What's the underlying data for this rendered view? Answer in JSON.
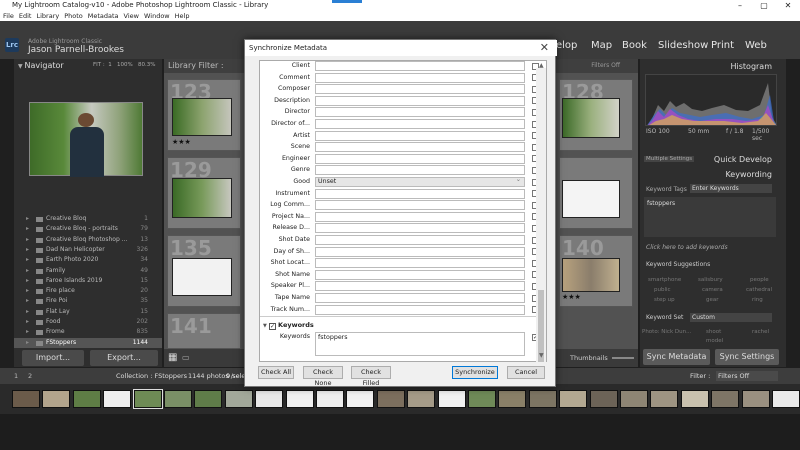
{
  "window": {
    "title": "My Lightroom Catalog-v10 - Adobe Photoshop Lightroom Classic - Library",
    "menu": [
      "File",
      "Edit",
      "Library",
      "Photo",
      "Metadata",
      "View",
      "Window",
      "Help"
    ],
    "controls": {
      "minimize": "–",
      "maximize": "▢",
      "close": "✕"
    }
  },
  "header": {
    "logo": "Lrc",
    "app_name": "Adobe Lightroom Classic",
    "user_name": "Jason Parnell-Brookes",
    "modules": [
      "elop",
      "Map",
      "Book",
      "Slideshow",
      "Print",
      "Web"
    ]
  },
  "navigator": {
    "title": "Navigator",
    "zoom_options": [
      "FIT",
      "1",
      "100%",
      "80.3%"
    ]
  },
  "collections": [
    {
      "name": "Creative Bloq",
      "count": "1"
    },
    {
      "name": "Creative Bloq - portraits",
      "count": "79"
    },
    {
      "name": "Creative Bloq Photoshop ...",
      "count": "13"
    },
    {
      "name": "Dad Nan Helicopter",
      "count": "326"
    },
    {
      "name": "Earth Photo 2020",
      "count": "34"
    },
    {
      "name": "Family",
      "count": "49"
    },
    {
      "name": "Faroe Islands 2019",
      "count": "15"
    },
    {
      "name": "Fire place",
      "count": "20"
    },
    {
      "name": "Fire Poi",
      "count": "35"
    },
    {
      "name": "Flat Lay",
      "count": "15"
    },
    {
      "name": "Food",
      "count": "202"
    },
    {
      "name": "Frome",
      "count": "835"
    },
    {
      "name": "FStoppers",
      "count": "1144",
      "selected": true
    }
  ],
  "left_buttons": {
    "import": "Import...",
    "export": "Export..."
  },
  "library_filter": {
    "label": "Library Filter :",
    "filters_off": "Filters Off"
  },
  "grid": {
    "cell_numbers": [
      "123",
      "128",
      "129",
      "135",
      "140",
      "141"
    ],
    "stars": "★★★",
    "thumbnails_label": "Thumbnails"
  },
  "right_panel": {
    "histogram": "Histogram",
    "exif": {
      "iso": "ISO 100",
      "focal": "50 mm",
      "aperture": "f / 1.8",
      "shutter": "1/500 sec"
    },
    "quick_develop": "Quick Develop",
    "multiple_settings": "Multiple Settings",
    "keywording": "Keywording",
    "keyword_tags_label": "Keyword Tags",
    "keyword_tags_value": "Enter Keywords",
    "keywords_value": "fstoppers",
    "click_to_add": "Click here to add keywords",
    "keyword_suggestions": "Keyword Suggestions",
    "suggestions": [
      "smartphone",
      "salisbury",
      "people",
      "public",
      "camera",
      "cathedral",
      "step up",
      "gear",
      "ring"
    ],
    "keyword_set_label": "Keyword Set",
    "keyword_set_value": "Custom",
    "keyword_set_items": [
      "Photo: Nick Dun...",
      "shoot",
      "rachel",
      "",
      "model",
      ""
    ],
    "sync_metadata": "Sync Metadata",
    "sync_settings": "Sync Settings"
  },
  "filmstrip_bar": {
    "collection": "Collection : FStoppers",
    "count": "1144 photos /",
    "selected": "9 selec",
    "filter_label": "Filter :",
    "filter_value": "Filters Off",
    "pages": [
      "1",
      "2"
    ]
  },
  "dialog": {
    "title": "Synchronize Metadata",
    "close": "✕",
    "fields": [
      {
        "label": "Client",
        "value": ""
      },
      {
        "label": "Comment",
        "value": ""
      },
      {
        "label": "Composer",
        "value": ""
      },
      {
        "label": "Description",
        "value": ""
      },
      {
        "label": "Director",
        "value": ""
      },
      {
        "label": "Director of...",
        "value": ""
      },
      {
        "label": "Artist",
        "value": ""
      },
      {
        "label": "Scene",
        "value": ""
      },
      {
        "label": "Engineer",
        "value": ""
      },
      {
        "label": "Genre",
        "value": ""
      },
      {
        "label": "Good",
        "value": "Unset"
      },
      {
        "label": "Instrument",
        "value": ""
      },
      {
        "label": "Log Comm...",
        "value": ""
      },
      {
        "label": "Project Na...",
        "value": ""
      },
      {
        "label": "Release D...",
        "value": ""
      },
      {
        "label": "Shot Date",
        "value": ""
      },
      {
        "label": "Day of Sh...",
        "value": ""
      },
      {
        "label": "Shot Locat...",
        "value": ""
      },
      {
        "label": "Shot Name",
        "value": ""
      },
      {
        "label": "Speaker Pl...",
        "value": ""
      },
      {
        "label": "Tape Name",
        "value": ""
      },
      {
        "label": "Track Num...",
        "value": ""
      }
    ],
    "keywords_section": "Keywords",
    "keywords_label": "Keywords",
    "keywords_value": "fstoppers",
    "buttons": {
      "check_all": "Check All",
      "check_none": "Check None",
      "check_filled": "Check Filled",
      "synchronize": "Synchronize",
      "cancel": "Cancel"
    }
  }
}
